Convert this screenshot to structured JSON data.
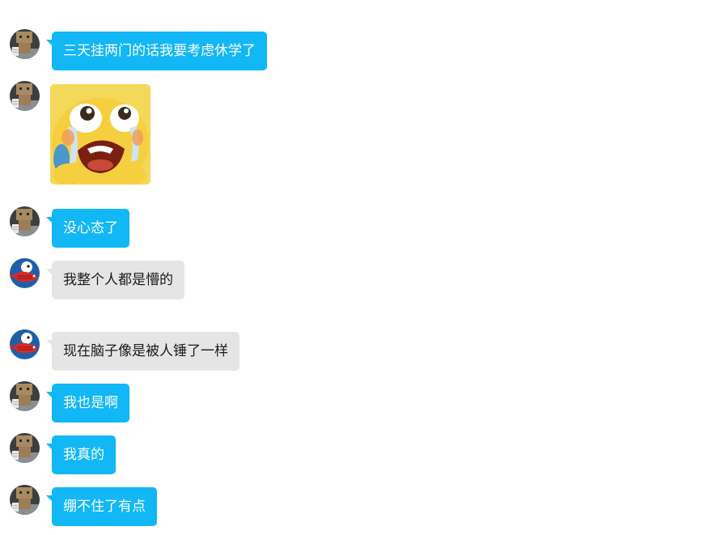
{
  "messages": [
    {
      "sender": "robot",
      "type": "text",
      "text": "三天挂两门的话我要考虑休学了"
    },
    {
      "sender": "robot",
      "type": "sticker",
      "sticker": "crying-face-sticker"
    },
    {
      "sender": "robot",
      "type": "text",
      "text": "没心态了"
    },
    {
      "sender": "koi",
      "type": "text",
      "text": "我整个人都是懵的"
    },
    {
      "sender": "koi",
      "type": "text",
      "text": "现在脑子像是被人锤了一样"
    },
    {
      "sender": "robot",
      "type": "text",
      "text": "我也是啊"
    },
    {
      "sender": "robot",
      "type": "text",
      "text": "我真的"
    },
    {
      "sender": "robot",
      "type": "text",
      "text": "绷不住了有点"
    }
  ],
  "colors": {
    "outgoing_bubble": "#12b7f5",
    "incoming_bubble": "#e5e5e5"
  }
}
